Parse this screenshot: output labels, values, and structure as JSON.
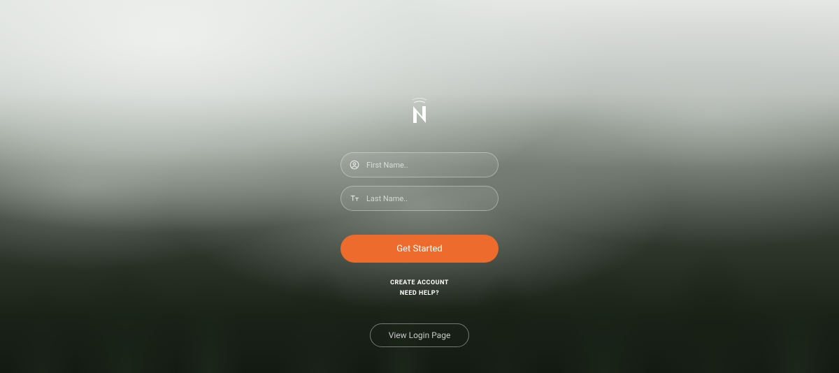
{
  "logo": {
    "letter": "N"
  },
  "form": {
    "first_name": {
      "placeholder": "First Name..",
      "value": ""
    },
    "last_name": {
      "placeholder": "Last Name..",
      "value": ""
    }
  },
  "buttons": {
    "primary": "Get Started",
    "secondary": "View Login Page"
  },
  "links": {
    "create_account": "CREATE ACCOUNT",
    "need_help": "NEED HELP?"
  },
  "colors": {
    "accent": "#ed6b2d"
  }
}
